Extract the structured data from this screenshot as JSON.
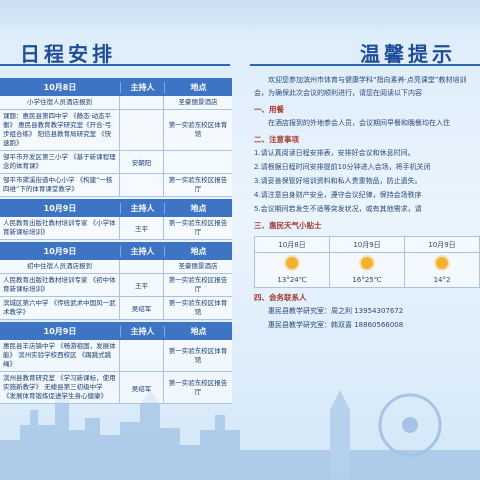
{
  "left_title": "日程安排",
  "right_title": "温馨提示",
  "table_headers": {
    "day1": "10月8日",
    "host": "主持人",
    "place": "地点"
  },
  "day1": {
    "rows": [
      {
        "content": "小学住宿人员酒店报到",
        "host": "",
        "place": "圣豪丽景酒店"
      },
      {
        "content": "课题：惠民县第四中学 《静态·动态平衡》 惠民县教育教学研究室《开合·弓步组合练》 阳信县教育局研究室 《快速跑》",
        "host": "",
        "place": "第一实验东校区体育馆"
      },
      {
        "content": "邹平市开发区第三小学 《基于新课程理念的体育课》",
        "host": "安朝阳",
        "place": ""
      },
      {
        "content": "邹平市黛溪街道中心小学 《构建“一核四维”下的体育课堂教学》",
        "host": "",
        "place": "第一实验东校区报告厅"
      }
    ]
  },
  "day2a_header": "10月9日",
  "day2a": {
    "rows": [
      {
        "content": "人民教育出版社教材培训专家 《小学体育新课标培训》",
        "host": "王平",
        "place": "第一实验东校区报告厅"
      }
    ]
  },
  "day2b_header": "10月9日",
  "day2b": {
    "rows": [
      {
        "content": "初中住宿人员酒店报到",
        "host": "",
        "place": "圣豪丽景酒店"
      },
      {
        "content": "人民教育出版社教材培训专家 《初中体育新课标培训》",
        "host": "王平",
        "place": "第一实验东校区报告厅"
      },
      {
        "content": "滨城区第六中学 《传统武术中国风一武术教学》",
        "host": "吴绍军",
        "place": "第一实验东校区体育馆"
      }
    ]
  },
  "day3_header": "10月9日",
  "day3": {
    "rows": [
      {
        "content": "惠民县丰店镇中学 《畅游祖国，发展体能》 滨州实验学校西校区 《踢跳式跳绳》",
        "host": "",
        "place": "第一实验东校区体育馆"
      },
      {
        "content": "滨州县教育研究室 《学习新课标，使用实施新教学》 无棣县第三初级中学 《发展体育锻炼促进学生身心健康》",
        "host": "吴绍军",
        "place": "第一实验东校区报告厅"
      }
    ]
  },
  "tips": {
    "intro": "欢迎您参加滨州市体育与健康学科“指向素养·点亮课堂”教材培训会，为确保此次会议的顺利进行，请您在阅读以下内容",
    "h1": "一、用餐",
    "p1": "在酒店报到的外地参会人员，会议期间早餐和晚餐均在入住",
    "h2": "二、注意事项",
    "items": [
      "1.请认真阅读日程安排表，安排好会议和休息时间。",
      "2.请根据日程时间安排提前10分钟进入会场，将手机关闭",
      "3.请妥善保管好培训资料和私人贵重物品，防止遗失。",
      "4.请注意自身财产安全，遵守会议纪律，保持会场秩序",
      "5.会议期间若发生不适等突发状况，或有其他需求，请"
    ],
    "h3": "三、惠民天气小贴士",
    "h4": "四、会务联系人",
    "contacts": [
      "惠民县教学研究室：周之利 13954307672",
      "惠民县教学研究室：韩双喜 18860566008"
    ]
  },
  "weather": [
    {
      "date": "10月8日",
      "temp": "13°24℃",
      "icon": "sun-icon"
    },
    {
      "date": "10月9日",
      "temp": "16°25℃",
      "icon": "sun-icon"
    },
    {
      "date": "10月9日",
      "temp": "14°2",
      "icon": "sun-icon"
    }
  ],
  "colors": {
    "header_bg": "#3e74c4",
    "title": "#1e4e9a",
    "accent_red": "#a8392e"
  }
}
